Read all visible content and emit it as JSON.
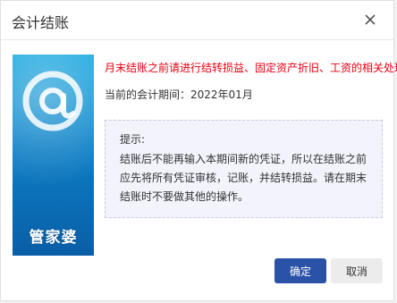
{
  "dialog": {
    "title": "会计结账",
    "close_icon": "close-icon"
  },
  "banner": {
    "logo_icon": "at-sign-logo-icon",
    "brand_text": "管家婆",
    "colors": {
      "top": "#1aa9e0",
      "bottom": "#0a5ea6"
    }
  },
  "content": {
    "warning": "月末结账之前请进行结转损益、固定资产折旧、工资的相关处理!",
    "period_text": "当前的会计期间：2022年01月",
    "hint": {
      "title": "提示:",
      "body": "结账后不能再输入本期间新的凭证，所以在结账之前应先将所有凭证审核，记账，并结转损益。请在期末结账时不要做其他的操作。"
    }
  },
  "buttons": {
    "ok_label": "确定",
    "cancel_label": "取消"
  },
  "colors": {
    "warning": "#e60012",
    "primary_button": "#2a53a8",
    "hint_background": "#f2f3fb"
  }
}
